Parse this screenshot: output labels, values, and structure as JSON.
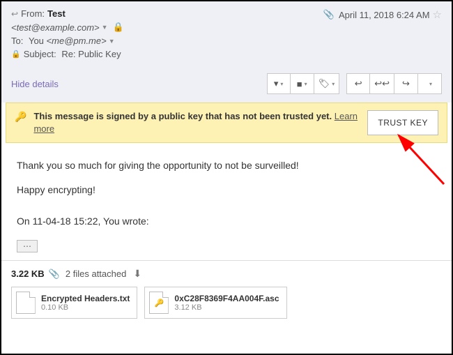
{
  "header": {
    "from_label": "From:",
    "from_name": "Test",
    "from_email": "<test@example.com>",
    "to_label": "To:",
    "to_name": "You",
    "to_email": "<me@pm.me>",
    "subject_label": "Subject:",
    "subject": "Re: Public Key",
    "date": "April 11, 2018 6:24 AM"
  },
  "toolbar": {
    "hide_details": "Hide details"
  },
  "banner": {
    "text": "This message is signed by a public key that has not been trusted yet.",
    "learn_more": "Learn more",
    "trust_button": "TRUST KEY"
  },
  "body": {
    "line1": "Thank you so much for giving the opportunity to not be surveilled!",
    "line2": "Happy encrypting!",
    "quote_header": "On 11-04-18 15:22, You wrote:"
  },
  "attachments": {
    "total_size": "3.22 KB",
    "count_text": "2 files attached",
    "files": [
      {
        "name": "Encrypted Headers.txt",
        "size": "0.10 KB",
        "icon": ""
      },
      {
        "name": "0xC28F8369F4AA004F.asc",
        "size": "3.12 KB",
        "icon": "🔑"
      }
    ]
  }
}
